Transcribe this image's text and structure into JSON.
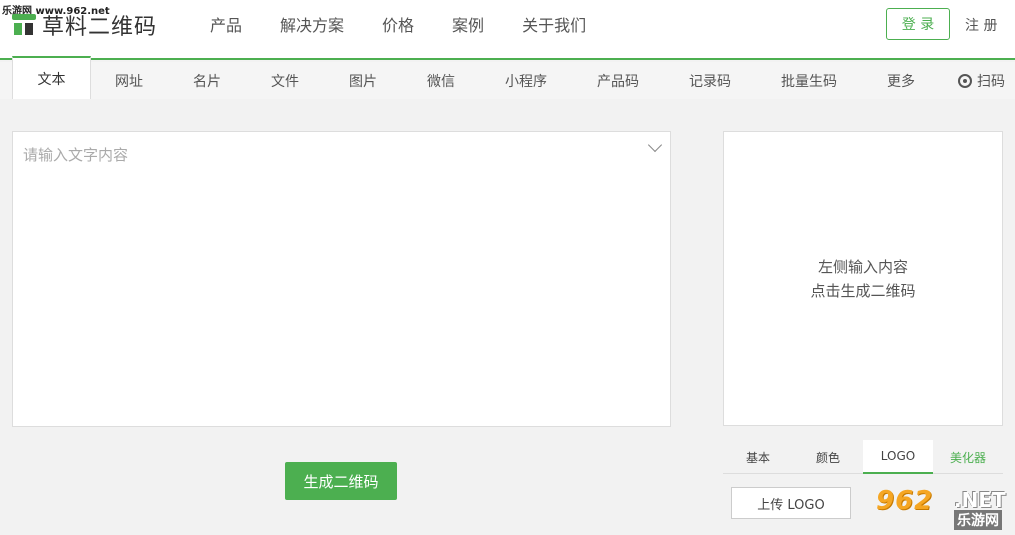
{
  "watermark_top": "乐游网 www.962.net",
  "logo": {
    "text": "草料二维码"
  },
  "nav": [
    "产品",
    "解决方案",
    "价格",
    "案例",
    "关于我们"
  ],
  "login_label": "登 录",
  "register_label": "注 册",
  "tabs": [
    "文本",
    "网址",
    "名片",
    "文件",
    "图片",
    "微信",
    "小程序",
    "产品码",
    "记录码",
    "批量生码",
    "更多"
  ],
  "scan_label": "扫码",
  "input": {
    "placeholder": "请输入文字内容",
    "value": ""
  },
  "generate_label": "生成二维码",
  "preview": {
    "line1": "左侧输入内容",
    "line2": "点击生成二维码"
  },
  "style_tabs": [
    "基本",
    "颜色",
    "LOGO",
    "美化器"
  ],
  "upload_label": "上传 LOGO",
  "watermark": {
    "num": "962",
    "net": ".NET",
    "cn": "乐游网"
  },
  "colors": {
    "accent": "#4caf50"
  }
}
